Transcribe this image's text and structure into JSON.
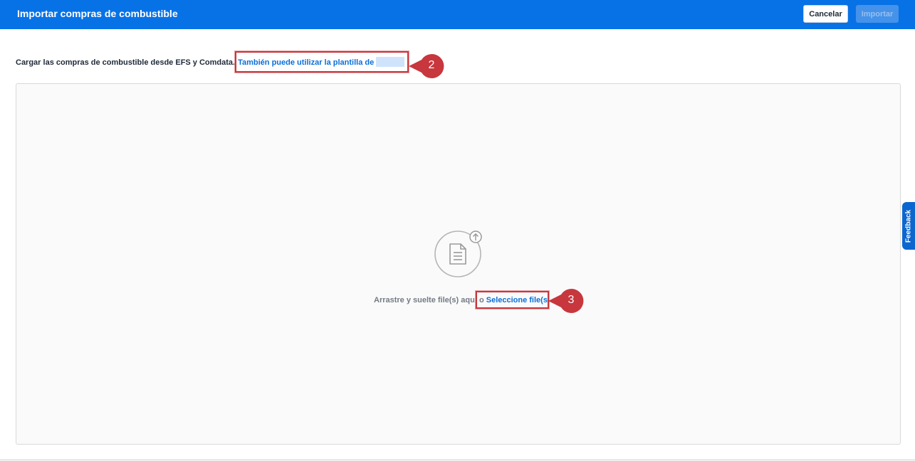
{
  "header": {
    "title": "Importar compras de combustible",
    "cancel_label": "Cancelar",
    "import_label": "Importar"
  },
  "intro": {
    "text": "Cargar las compras de combustible desde EFS y Comdata.",
    "link_text": "También puede utilizar la plantilla de"
  },
  "dropzone": {
    "icon": "file-upload-icon",
    "drag_text": "Arrastre y suelte file(s) aquí o",
    "select_link": "Seleccione file(s)"
  },
  "feedback": {
    "label": "Feedback"
  },
  "callouts": [
    {
      "number": "2"
    },
    {
      "number": "3"
    }
  ],
  "colors": {
    "header_bg": "#0772e6",
    "link": "#0a6fd8",
    "callout": "#c7373d",
    "feedback_bg": "#0b66cf"
  }
}
